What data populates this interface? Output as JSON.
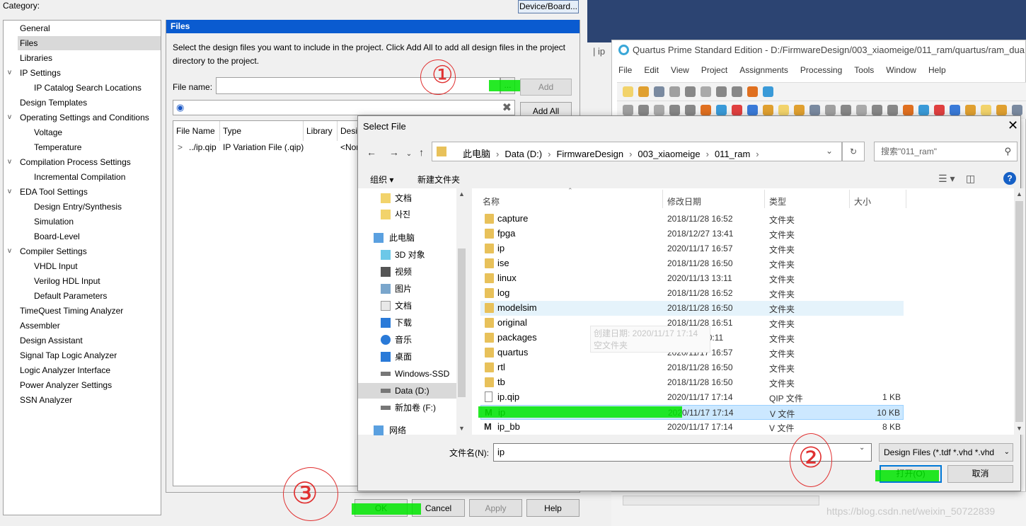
{
  "settings": {
    "category_label": "Category:",
    "device_button": "Device/Board...",
    "tree": [
      {
        "label": "General",
        "indent": 0,
        "expand": ""
      },
      {
        "label": "Files",
        "indent": 0,
        "expand": "",
        "selected": true
      },
      {
        "label": "Libraries",
        "indent": 0,
        "expand": ""
      },
      {
        "label": "IP Settings",
        "indent": 0,
        "expand": "v"
      },
      {
        "label": "IP Catalog Search Locations",
        "indent": 1,
        "expand": ""
      },
      {
        "label": "Design Templates",
        "indent": 0,
        "expand": ""
      },
      {
        "label": "Operating Settings and Conditions",
        "indent": 0,
        "expand": "v"
      },
      {
        "label": "Voltage",
        "indent": 1,
        "expand": ""
      },
      {
        "label": "Temperature",
        "indent": 1,
        "expand": ""
      },
      {
        "label": "Compilation Process Settings",
        "indent": 0,
        "expand": "v"
      },
      {
        "label": "Incremental Compilation",
        "indent": 1,
        "expand": ""
      },
      {
        "label": "EDA Tool Settings",
        "indent": 0,
        "expand": "v"
      },
      {
        "label": "Design Entry/Synthesis",
        "indent": 1,
        "expand": ""
      },
      {
        "label": "Simulation",
        "indent": 1,
        "expand": ""
      },
      {
        "label": "Board-Level",
        "indent": 1,
        "expand": ""
      },
      {
        "label": "Compiler Settings",
        "indent": 0,
        "expand": "v"
      },
      {
        "label": "VHDL Input",
        "indent": 1,
        "expand": ""
      },
      {
        "label": "Verilog HDL Input",
        "indent": 1,
        "expand": ""
      },
      {
        "label": "Default Parameters",
        "indent": 1,
        "expand": ""
      },
      {
        "label": "TimeQuest Timing Analyzer",
        "indent": 0,
        "expand": ""
      },
      {
        "label": "Assembler",
        "indent": 0,
        "expand": ""
      },
      {
        "label": "Design Assistant",
        "indent": 0,
        "expand": ""
      },
      {
        "label": "Signal Tap Logic Analyzer",
        "indent": 0,
        "expand": ""
      },
      {
        "label": "Logic Analyzer Interface",
        "indent": 0,
        "expand": ""
      },
      {
        "label": "Power Analyzer Settings",
        "indent": 0,
        "expand": ""
      },
      {
        "label": "SSN Analyzer",
        "indent": 0,
        "expand": ""
      }
    ],
    "panel_title": "Files",
    "description": "Select the design files you want to include in the project. Click Add All to add all design files in the project directory to the project.",
    "file_name_label": "File name:",
    "browse_label": "...",
    "add_label": "Add",
    "add_all_label": "Add All",
    "table_headers": [
      "File Name",
      "Type",
      "Library",
      "Desi"
    ],
    "table_row": {
      "expand": ">",
      "file": "../ip.qip",
      "type": "IP Variation File (.qip)",
      "lib": "",
      "design": "<Nor"
    },
    "buttons": {
      "ok": "OK",
      "cancel": "Cancel",
      "apply": "Apply",
      "help": "Help"
    }
  },
  "quartus": {
    "title": "Quartus Prime Standard Edition - D:/FirmwareDesign/003_xiaomeige/011_ram/quartus/ram_dua",
    "menu": [
      "File",
      "Edit",
      "View",
      "Project",
      "Assignments",
      "Processing",
      "Tools",
      "Window",
      "Help"
    ],
    "side_tab": "| ip"
  },
  "select_file": {
    "title": "Select File",
    "breadcrumbs": [
      "此电脑",
      "Data (D:)",
      "FirmwareDesign",
      "003_xiaomeige",
      "011_ram"
    ],
    "search_placeholder": "搜索\"011_ram\"",
    "organize": "组织 ▾",
    "new_folder": "新建文件夹",
    "sidebar": [
      {
        "label": "文档",
        "icon": "folder",
        "indent": 1
      },
      {
        "label": "사진",
        "icon": "folder",
        "indent": 1
      },
      {
        "label": "此电脑",
        "icon": "pc",
        "indent": 0
      },
      {
        "label": "3D 对象",
        "icon": "cube",
        "indent": 1
      },
      {
        "label": "视频",
        "icon": "video",
        "indent": 1
      },
      {
        "label": "图片",
        "icon": "picture",
        "indent": 1
      },
      {
        "label": "文档",
        "icon": "doc",
        "indent": 1
      },
      {
        "label": "下载",
        "icon": "download",
        "indent": 1
      },
      {
        "label": "音乐",
        "icon": "music",
        "indent": 1
      },
      {
        "label": "桌面",
        "icon": "desktop",
        "indent": 1
      },
      {
        "label": "Windows-SSD",
        "icon": "drive",
        "indent": 1
      },
      {
        "label": "Data (D:)",
        "icon": "drive",
        "indent": 1,
        "selected": true
      },
      {
        "label": "新加卷 (F:)",
        "icon": "drive",
        "indent": 1
      },
      {
        "label": "网络",
        "icon": "network",
        "indent": 0
      }
    ],
    "columns": [
      "名称",
      "修改日期",
      "类型",
      "大小"
    ],
    "files": [
      {
        "name": "capture",
        "date": "2018/11/28 16:52",
        "type": "文件夹",
        "size": "",
        "kind": "folder"
      },
      {
        "name": "fpga",
        "date": "2018/12/27 13:41",
        "type": "文件夹",
        "size": "",
        "kind": "folder"
      },
      {
        "name": "ip",
        "date": "2020/11/17 16:57",
        "type": "文件夹",
        "size": "",
        "kind": "folder"
      },
      {
        "name": "ise",
        "date": "2018/11/28 16:50",
        "type": "文件夹",
        "size": "",
        "kind": "folder"
      },
      {
        "name": "linux",
        "date": "2020/11/13 13:11",
        "type": "文件夹",
        "size": "",
        "kind": "folder"
      },
      {
        "name": "log",
        "date": "2018/11/28 16:52",
        "type": "文件夹",
        "size": "",
        "kind": "folder"
      },
      {
        "name": "modelsim",
        "date": "2018/11/28 16:50",
        "type": "文件夹",
        "size": "",
        "kind": "folder",
        "hover": true
      },
      {
        "name": "original",
        "date": "2018/11/28 16:51",
        "type": "文件夹",
        "size": "",
        "kind": "folder"
      },
      {
        "name": "packages",
        "date": "2019/7/8 10:11",
        "type": "文件夹",
        "size": "",
        "kind": "folder"
      },
      {
        "name": "quartus",
        "date": "2020/11/17 16:57",
        "type": "文件夹",
        "size": "",
        "kind": "folder"
      },
      {
        "name": "rtl",
        "date": "2018/11/28 16:50",
        "type": "文件夹",
        "size": "",
        "kind": "folder"
      },
      {
        "name": "tb",
        "date": "2018/11/28 16:50",
        "type": "文件夹",
        "size": "",
        "kind": "folder"
      },
      {
        "name": "ip.qip",
        "date": "2020/11/17 17:14",
        "type": "QIP 文件",
        "size": "1 KB",
        "kind": "file"
      },
      {
        "name": "ip",
        "date": "2020/11/17 17:14",
        "type": "V 文件",
        "size": "10 KB",
        "kind": "v",
        "selected": true
      },
      {
        "name": "ip_bb",
        "date": "2020/11/17 17:14",
        "type": "V 文件",
        "size": "8 KB",
        "kind": "v"
      }
    ],
    "tooltip": {
      "line1": "创建日期: 2020/11/17 17:14",
      "line2": "空文件夹"
    },
    "file_name_label": "文件名(N):",
    "file_name_value": "ip",
    "filter": "Design Files (*.tdf *.vhd *.vhd",
    "open_label": "打开(O)",
    "cancel_label": "取消"
  },
  "annotations": {
    "one": "①",
    "two": "②",
    "three": "③"
  },
  "watermark": "https://blog.csdn.net/weixin_50722839"
}
